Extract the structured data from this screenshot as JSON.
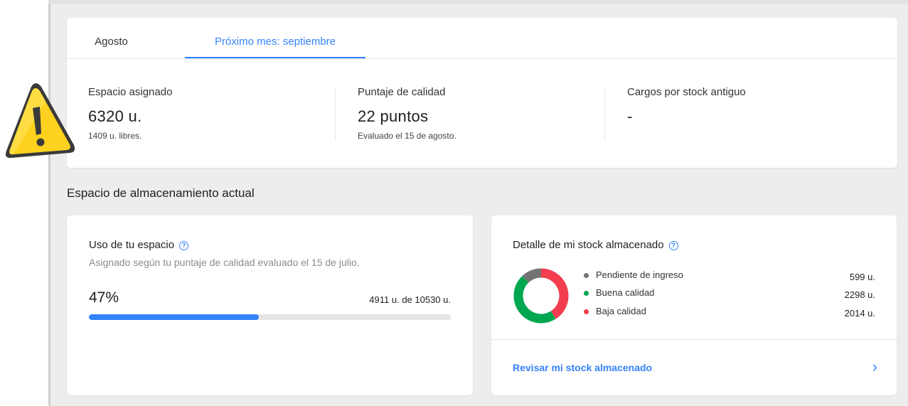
{
  "tabs": [
    {
      "label": "Agosto",
      "active": false
    },
    {
      "label": "Próximo mes: septiembre",
      "active": true
    }
  ],
  "metrics": [
    {
      "label": "Espacio asignado",
      "value": "6320 u.",
      "sub": "1409 u. libres."
    },
    {
      "label": "Puntaje de calidad",
      "value": "22 puntos",
      "sub": "Evaluado el 15 de agosto."
    },
    {
      "label": "Cargos por stock antiguo",
      "value": "-",
      "sub": ""
    }
  ],
  "section_title": "Espacio de almacenamiento actual",
  "usage": {
    "title": "Uso de tu espacio",
    "subtitle": "Asignado según tu puntaje de calidad evaluado el 15 de julio.",
    "percent_label": "47%",
    "percent_value": 0.47,
    "units_label": "4911 u. de 10530 u."
  },
  "detail": {
    "title": "Detalle de mi stock almacenado",
    "legend": [
      {
        "label": "Pendiente de ingreso",
        "value_label": "599 u.",
        "value": 599,
        "color": "#737373"
      },
      {
        "label": "Buena calidad",
        "value_label": "2298 u.",
        "value": 2298,
        "color": "#00a650"
      },
      {
        "label": "Baja calidad",
        "value_label": "2014 u.",
        "value": 2014,
        "color": "#f23d4f"
      }
    ],
    "link_label": "Revisar mi stock almacenado",
    "link_chevron": "›"
  },
  "colors": {
    "accent": "#3483fa",
    "warning": "#ffd21f"
  },
  "icons": {
    "help": "help-circle-icon",
    "warning": "warning-triangle-icon",
    "chevron": "chevron-right-icon"
  }
}
